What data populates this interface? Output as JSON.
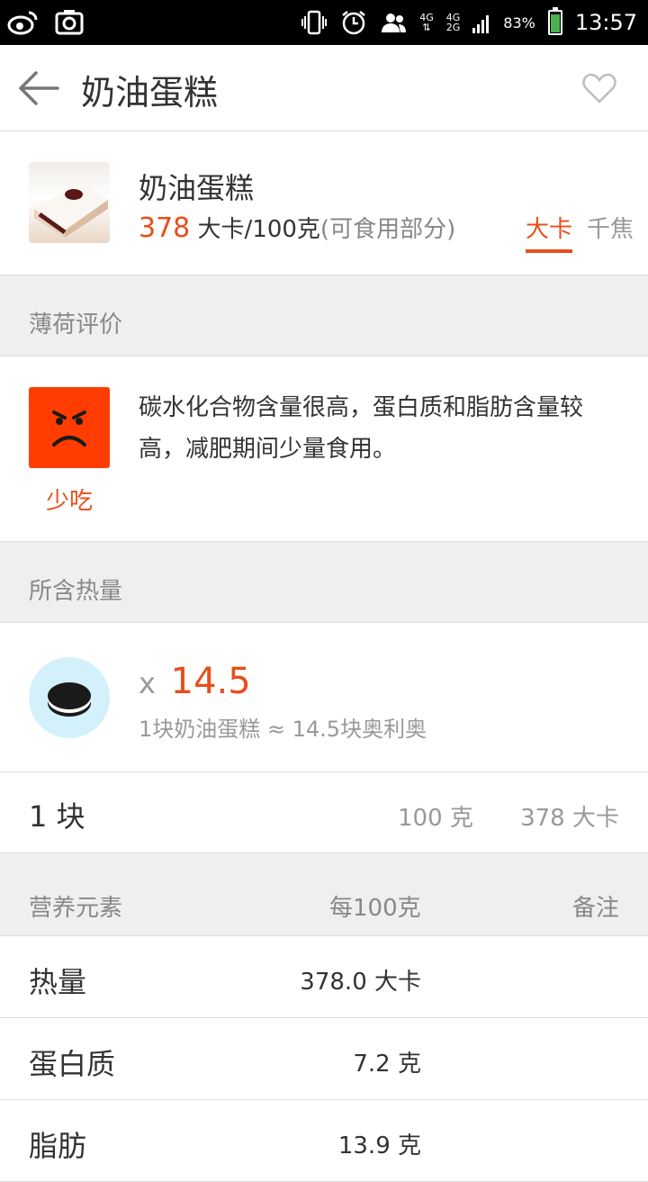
{
  "status_bar": {
    "network_1": "4G",
    "network_2a": "4G",
    "network_2b": "2G",
    "battery": "83%",
    "time": "13:57",
    "battery_level": 0.83
  },
  "header": {
    "title": "奶油蛋糕"
  },
  "food": {
    "name": "奶油蛋糕",
    "calories": "378",
    "calorie_unit": "大卡/100克",
    "calorie_note": "(可食用部分)",
    "unit_tabs": [
      "大卡",
      "千焦"
    ]
  },
  "evaluation": {
    "section_title": "薄荷评价",
    "label": "少吃",
    "text": "碳水化合物含量很高，蛋白质和脂肪含量较高，减肥期间少量食用。",
    "face_color": "#ff3d00"
  },
  "equivalent": {
    "section_title": "所含热量",
    "multiplier_prefix": "x",
    "multiplier": "14.5",
    "description": "1块奶油蛋糕 ≈ 14.5块奥利奥"
  },
  "serving": {
    "unit": "1 块",
    "weight": "100 克",
    "calories": "378 大卡"
  },
  "nutrition": {
    "headers": [
      "营养元素",
      "每100克",
      "备注"
    ],
    "rows": [
      {
        "name": "热量",
        "value": "378.0 大卡"
      },
      {
        "name": "蛋白质",
        "value": "7.2 克"
      },
      {
        "name": "脂肪",
        "value": "13.9 克"
      }
    ]
  },
  "colors": {
    "accent": "#e84e1b",
    "section_bg": "#efefef",
    "equiv_icon_bg": "#d3f1fa"
  }
}
